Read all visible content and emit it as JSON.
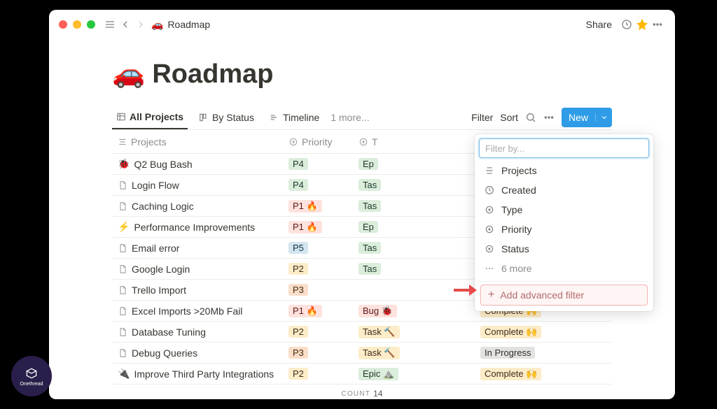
{
  "topbar": {
    "breadcrumb_emoji": "🚗",
    "breadcrumb_title": "Roadmap",
    "share": "Share"
  },
  "page": {
    "emoji": "🚗",
    "title": "Roadmap"
  },
  "tabs": {
    "all_projects": "All Projects",
    "by_status": "By Status",
    "timeline": "Timeline",
    "more": "1 more..."
  },
  "toolbar": {
    "filter": "Filter",
    "sort": "Sort",
    "new": "New"
  },
  "columns": {
    "projects": "Projects",
    "priority": "Priority",
    "type": "T"
  },
  "rows": [
    {
      "emoji": "🐞",
      "title": "Q2 Bug Bash",
      "priority": "P4",
      "pclass": "green",
      "type": "Ep",
      "temoji": "",
      "status": ""
    },
    {
      "emoji": "",
      "title": "Login Flow",
      "priority": "P4",
      "pclass": "green",
      "type": "Tas",
      "temoji": "",
      "status": ""
    },
    {
      "emoji": "",
      "title": "Caching Logic",
      "priority": "P1",
      "pclass": "red",
      "pextra": "🔥",
      "type": "Tas",
      "temoji": "",
      "status": ""
    },
    {
      "emoji": "⚡",
      "title": "Performance Improvements",
      "priority": "P1",
      "pclass": "red",
      "pextra": "🔥",
      "type": "Ep",
      "temoji": "",
      "status": ""
    },
    {
      "emoji": "",
      "title": "Email error",
      "priority": "P5",
      "pclass": "blue",
      "type": "Tas",
      "temoji": "",
      "status": ""
    },
    {
      "emoji": "",
      "title": "Google Login",
      "priority": "P2",
      "pclass": "yellow",
      "type": "Tas",
      "temoji": "",
      "status": ""
    },
    {
      "emoji": "",
      "title": "Trello Import",
      "priority": "P3",
      "pclass": "orange",
      "type": "",
      "temoji": "",
      "status": ""
    },
    {
      "emoji": "",
      "title": "Excel Imports >20Mb Fail",
      "priority": "P1",
      "pclass": "red",
      "pextra": "🔥",
      "type": "Bug",
      "temoji": "🐞",
      "tclass": "red",
      "status": "Complete",
      "sclass": "yellow",
      "semoji": "🙌"
    },
    {
      "emoji": "",
      "title": "Database Tuning",
      "priority": "P2",
      "pclass": "yellow",
      "type": "Task",
      "temoji": "🔨",
      "tclass": "yellow",
      "status": "Complete",
      "sclass": "yellow",
      "semoji": "🙌"
    },
    {
      "emoji": "",
      "title": "Debug Queries",
      "priority": "P3",
      "pclass": "orange",
      "type": "Task",
      "temoji": "🔨",
      "tclass": "yellow",
      "status": "In Progress",
      "sclass": "gray"
    },
    {
      "emoji": "🔌",
      "title": "Improve Third Party Integrations",
      "priority": "P2",
      "pclass": "yellow",
      "type": "Epic",
      "temoji": "⛰️",
      "tclass": "green",
      "status": "Complete",
      "sclass": "yellow",
      "semoji": "🙌"
    }
  ],
  "count": {
    "label": "COUNT",
    "value": "14"
  },
  "filter_popover": {
    "placeholder": "Filter by...",
    "items": [
      "Projects",
      "Created",
      "Type",
      "Priority",
      "Status"
    ],
    "more": "6 more",
    "advanced": "Add advanced filter"
  },
  "brand": "Onethread"
}
